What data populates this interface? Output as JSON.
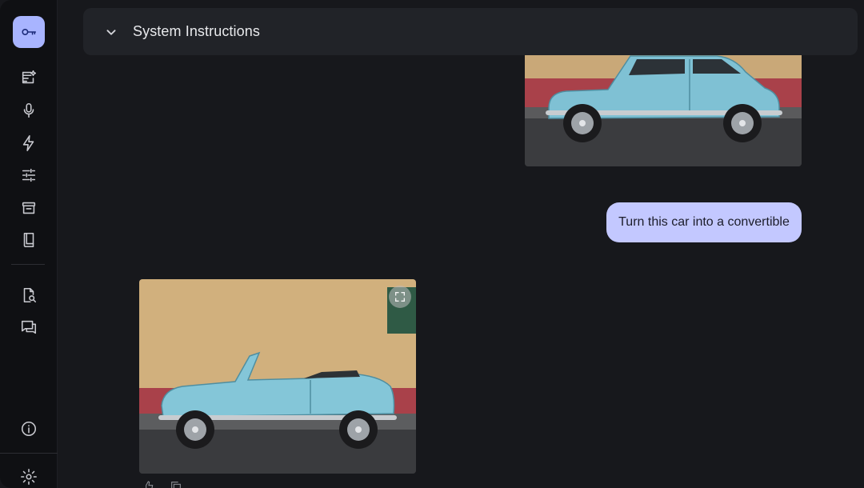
{
  "header": {
    "title": "System Instructions",
    "chevron_icon": "chevron-down-icon"
  },
  "sidebar": {
    "items": [
      {
        "name": "key-icon",
        "active": true
      },
      {
        "name": "new-chat-icon"
      },
      {
        "name": "microphone-icon"
      },
      {
        "name": "bolt-icon"
      },
      {
        "name": "tune-icon"
      },
      {
        "name": "archive-icon"
      },
      {
        "name": "book-icon"
      },
      {
        "name": "document-search-icon"
      },
      {
        "name": "chat-icon"
      },
      {
        "name": "info-icon"
      },
      {
        "name": "settings-icon"
      }
    ]
  },
  "chat": {
    "user_message": "Turn this car into a convertible",
    "expand_icon": "fullscreen-icon"
  },
  "colors": {
    "background": "#17181c",
    "sidebar": "#0f1013",
    "accent": "#a8b4ff",
    "user_bubble": "#c3c8ff",
    "header_bar": "#212328"
  }
}
